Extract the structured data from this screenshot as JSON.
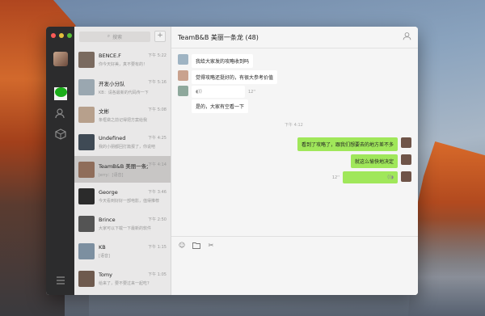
{
  "desktop": {
    "wallpaper": "mountain-dusk"
  },
  "colors": {
    "accent_green": "#1aad19",
    "bubble_green": "#a0e75a",
    "rail_bg": "#2c2c2d"
  },
  "window": {
    "traffic_lights": [
      "#fc5b57",
      "#e5bf3c",
      "#57c038"
    ],
    "rail": {
      "icons": [
        "chat-icon",
        "contacts-icon",
        "favorites-icon",
        "menu-icon"
      ]
    },
    "search": {
      "placeholder": "搜索",
      "icon": "search-icon"
    },
    "add_button": {
      "label": "+"
    }
  },
  "sessions": [
    {
      "name": "BENCE.F",
      "time": "下午 5:22",
      "msg": "你今天好美，真不要有的！",
      "color": "#7a6a5f"
    },
    {
      "name": "开发小分队",
      "time": "下午 5:16",
      "msg": "KB：请各最新的代码传一下",
      "color": "#9aa7b0"
    },
    {
      "name": "文彬",
      "time": "下午 5:08",
      "msg": "条框做之前记得把方案给我",
      "color": "#b7a08c"
    },
    {
      "name": "Undefined",
      "time": "下午 4:25",
      "msg": "我的小朋都回打篇报了，你说吧",
      "color": "#3f4a55"
    },
    {
      "name": "TeamB&B 美丽一条龙",
      "time": "下午 4:14",
      "msg": "Jerry：[语音]",
      "color": "#8f6d5a"
    },
    {
      "name": "George",
      "time": "下午 3:46",
      "msg": "今天看到好好一部电影，值得推荐",
      "color": "#2b2b2b"
    },
    {
      "name": "Brince",
      "time": "下午 2:50",
      "msg": "大家可以下载一下最新的软件",
      "color": "#545454"
    },
    {
      "name": "KB",
      "time": "下午 1:15",
      "msg": "[语音]",
      "color": "#7c8fa0"
    },
    {
      "name": "Tomy",
      "time": "下午 1:05",
      "msg": "给来了，要不要过来一起吃?",
      "color": "#6e5a4e"
    }
  ],
  "active_session_index": 4,
  "chat": {
    "title": "TeamB&B 美丽一条龙 (48)",
    "header_icon": "person-icon",
    "messages": [
      {
        "dir": "in",
        "text": "我给大家发的攻略收到吗",
        "color": "#9fb4c3"
      },
      {
        "dir": "in",
        "text": "觉得攻略还挺好的，有很大参考价值",
        "color": "#c9a28e"
      },
      {
        "dir": "in",
        "text": "",
        "voice_duration": "12''",
        "color": "#8ea89c"
      },
      {
        "dir": "in",
        "text": "是的，大家有空看一下",
        "color": ""
      },
      {
        "dir": "stamp",
        "text": "下午 4:12"
      },
      {
        "dir": "out",
        "text": "看到了攻略了，跟我们想要去的地方差不多",
        "color": "#6f5448"
      },
      {
        "dir": "out",
        "text": "就这么愉快地决定",
        "color": "#6f5448"
      },
      {
        "dir": "out",
        "text": "",
        "voice_duration": "12''",
        "color": "#6f5448"
      }
    ]
  },
  "composer": {
    "tools": [
      "emoji-icon",
      "folder-icon",
      "scissors-icon"
    ]
  }
}
